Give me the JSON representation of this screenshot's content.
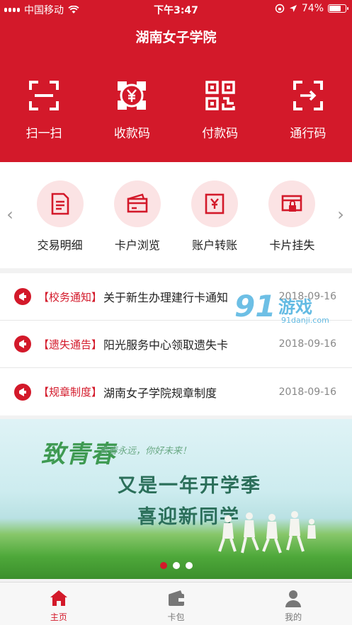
{
  "status_bar": {
    "carrier": "中国移动",
    "time": "下午3:47",
    "battery": "74%",
    "battery_level": 0.74
  },
  "app_title": "湖南女子学院",
  "quick_actions": [
    {
      "label": "扫一扫",
      "icon": "scan-icon"
    },
    {
      "label": "收款码",
      "icon": "receive-code-icon"
    },
    {
      "label": "付款码",
      "icon": "pay-code-icon"
    },
    {
      "label": "通行码",
      "icon": "pass-code-icon"
    }
  ],
  "menu_items": [
    {
      "label": "交易明细",
      "icon": "transaction-detail-icon"
    },
    {
      "label": "卡户浏览",
      "icon": "card-browse-icon"
    },
    {
      "label": "账户转账",
      "icon": "transfer-icon"
    },
    {
      "label": "卡片挂失",
      "icon": "report-loss-icon"
    }
  ],
  "news": [
    {
      "tag": "【校务通知】",
      "title": "关于新生办理建行卡通知",
      "date": "2018-09-16"
    },
    {
      "tag": "【遗失通告】",
      "title": "阳光服务中心领取遗失卡",
      "date": "2018-09-16"
    },
    {
      "tag": "【规章制度】",
      "title": "湖南女子学院规章制度",
      "date": "2018-09-16"
    }
  ],
  "banner": {
    "title": "致青春",
    "subtitle": "青春永远，你好未来！",
    "line1": "又是一年开学季",
    "line2": "喜迎新同学",
    "slide_count": 3,
    "active_slide": 1
  },
  "watermark": {
    "brand_number": "91",
    "brand_text": "游戏",
    "url": "91danji.com"
  },
  "tabs": [
    {
      "label": "主页",
      "icon": "home-icon",
      "active": true
    },
    {
      "label": "卡包",
      "icon": "wallet-icon",
      "active": false
    },
    {
      "label": "我的",
      "icon": "profile-icon",
      "active": false
    }
  ],
  "colors": {
    "primary": "#d3192a",
    "menu_circle": "#fbe3e4"
  }
}
